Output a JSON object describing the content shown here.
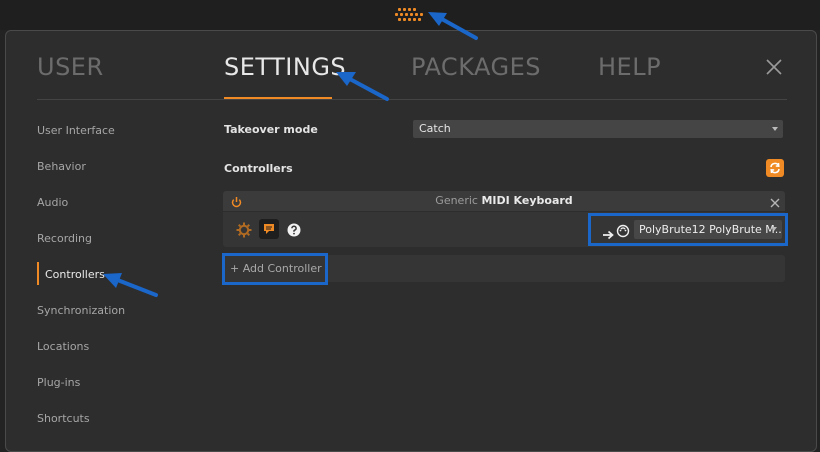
{
  "tabs": [
    {
      "label": "USER",
      "active": false
    },
    {
      "label": "SETTINGS",
      "active": true
    },
    {
      "label": "PACKAGES",
      "active": false
    },
    {
      "label": "HELP",
      "active": false
    }
  ],
  "sidebar": {
    "items": [
      {
        "label": "User Interface"
      },
      {
        "label": "Behavior"
      },
      {
        "label": "Audio"
      },
      {
        "label": "Recording"
      },
      {
        "label": "Controllers",
        "active": true
      },
      {
        "label": "Synchronization"
      },
      {
        "label": "Locations"
      },
      {
        "label": "Plug-ins"
      },
      {
        "label": "Shortcuts"
      }
    ]
  },
  "settings": {
    "takeover_label": "Takeover mode",
    "takeover_value": "Catch",
    "controllers_label": "Controllers"
  },
  "controller": {
    "vendor": "Generic",
    "name": "MIDI Keyboard",
    "port_value": "PolyBrute12 PolyBrute M..."
  },
  "add_controller_label": "+ Add Controller",
  "colors": {
    "accent": "#f08a24",
    "annotation_blue": "#1a66c9"
  }
}
